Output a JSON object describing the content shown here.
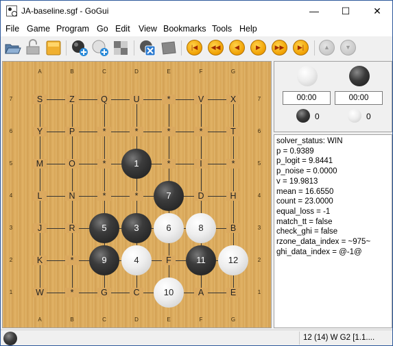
{
  "window": {
    "title": "JA-baseline.sgf - GoGui",
    "minimize_glyph": "—",
    "maximize_glyph": "☐",
    "close_glyph": "✕"
  },
  "menu": [
    "File",
    "Game",
    "Program",
    "Go",
    "Edit",
    "View",
    "Bookmarks",
    "Tools",
    "Help"
  ],
  "toolbar": {
    "buttons": [
      "open-icon",
      "save-icon",
      "new-game-icon",
      "attach-program-icon",
      "play-icon",
      "setup-icon",
      "interrupt-icon",
      "score-icon"
    ],
    "navigation": [
      "beginning-icon",
      "back-10-icon",
      "back-icon",
      "forward-icon",
      "forward-10-icon",
      "end-icon",
      "previous-variation-icon",
      "next-variation-icon"
    ]
  },
  "board": {
    "columns": [
      "A",
      "B",
      "C",
      "D",
      "E",
      "F",
      "G"
    ],
    "rows": [
      "7",
      "6",
      "5",
      "4",
      "3",
      "2",
      "1"
    ],
    "labels": [
      {
        "point": "A7",
        "text": "S"
      },
      {
        "point": "B7",
        "text": "Z"
      },
      {
        "point": "C7",
        "text": "Q"
      },
      {
        "point": "D7",
        "text": "U"
      },
      {
        "point": "E7",
        "text": "*"
      },
      {
        "point": "F7",
        "text": "V"
      },
      {
        "point": "G7",
        "text": "X"
      },
      {
        "point": "A6",
        "text": "Y"
      },
      {
        "point": "B6",
        "text": "P"
      },
      {
        "point": "C6",
        "text": "*"
      },
      {
        "point": "D6",
        "text": "*"
      },
      {
        "point": "E6",
        "text": "*"
      },
      {
        "point": "F6",
        "text": "*"
      },
      {
        "point": "G6",
        "text": "T"
      },
      {
        "point": "A5",
        "text": "M"
      },
      {
        "point": "B5",
        "text": "O"
      },
      {
        "point": "C5",
        "text": "*"
      },
      {
        "point": "E5",
        "text": "*"
      },
      {
        "point": "F5",
        "text": "I"
      },
      {
        "point": "G5",
        "text": "*"
      },
      {
        "point": "A4",
        "text": "L"
      },
      {
        "point": "B4",
        "text": "N"
      },
      {
        "point": "C4",
        "text": "*"
      },
      {
        "point": "D4",
        "text": "*"
      },
      {
        "point": "F4",
        "text": "D"
      },
      {
        "point": "G4",
        "text": "H"
      },
      {
        "point": "A3",
        "text": "J"
      },
      {
        "point": "B3",
        "text": "R"
      },
      {
        "point": "G3",
        "text": "B"
      },
      {
        "point": "A2",
        "text": "K"
      },
      {
        "point": "B2",
        "text": "*"
      },
      {
        "point": "E2",
        "text": "F"
      },
      {
        "point": "A1",
        "text": "W"
      },
      {
        "point": "B1",
        "text": "*"
      },
      {
        "point": "C1",
        "text": "G"
      },
      {
        "point": "D1",
        "text": "C"
      },
      {
        "point": "F1",
        "text": "A"
      },
      {
        "point": "G1",
        "text": "E"
      }
    ],
    "stones": [
      {
        "point": "D5",
        "color": "black",
        "number": "1"
      },
      {
        "point": "E4",
        "color": "black",
        "number": "7"
      },
      {
        "point": "C3",
        "color": "black",
        "number": "5"
      },
      {
        "point": "D3",
        "color": "black",
        "number": "3"
      },
      {
        "point": "E3",
        "color": "white",
        "number": "6"
      },
      {
        "point": "F3",
        "color": "white",
        "number": "8"
      },
      {
        "point": "C2",
        "color": "black",
        "number": "9"
      },
      {
        "point": "D2",
        "color": "white",
        "number": "4"
      },
      {
        "point": "F2",
        "color": "black",
        "number": "11"
      },
      {
        "point": "G2",
        "color": "white",
        "number": "12"
      },
      {
        "point": "E1",
        "color": "white",
        "number": "10"
      }
    ]
  },
  "clock": {
    "white_time": "00:00",
    "black_time": "00:00",
    "black_captures": "0",
    "white_captures": "0"
  },
  "analysis": [
    "solver_status: WIN",
    "p = 0.9389",
    "p_logit = 9.8441",
    "p_noise = 0.0000",
    "v = 19.9813",
    "mean = 16.6550",
    "count = 23.0000",
    "equal_loss = -1",
    "match_tt = false",
    "check_ghi = false",
    "rzone_data_index = ~975~",
    "ghi_data_index = @-1@"
  ],
  "status": {
    "to_move": "black",
    "move_info": "12 (14) W G2 [1.1...."
  }
}
